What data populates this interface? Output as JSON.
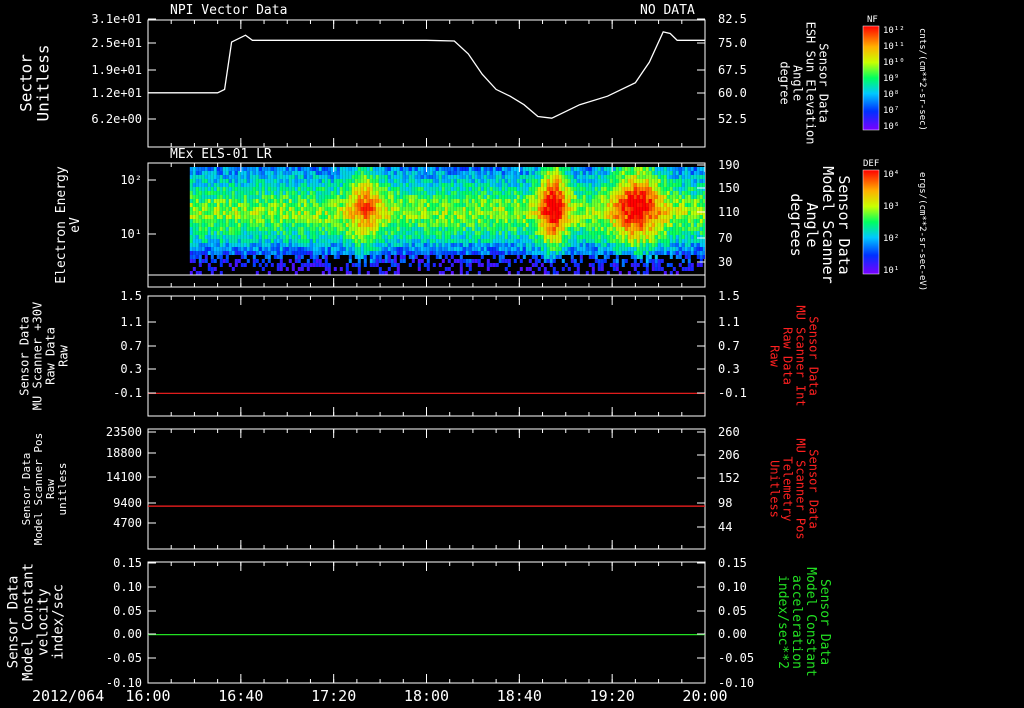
{
  "colors": {
    "white": "#ffffff",
    "red": "#ff2020",
    "green": "#22e022",
    "axis": "#ffffff"
  },
  "chart_data": [
    {
      "type": "line",
      "panel": "p1",
      "title": "NPI Vector Data",
      "status": "NO DATA",
      "ylabel_left": [
        "Sector",
        "Unitless"
      ],
      "yticks_left": [
        "3.1e+01",
        "2.5e+01",
        "1.9e+01",
        "1.2e+01",
        "6.2e+00"
      ],
      "ylabel_right": [
        "Sensor Data",
        "ESH Sun Elevation",
        "Angle",
        "degree"
      ],
      "yticks_right": [
        "82.5",
        "75.0",
        "67.5",
        "60.0",
        "52.5"
      ],
      "ylim": [
        45,
        82.5
      ],
      "xlim": [
        16.0,
        20.0
      ],
      "series": [
        {
          "color": "white",
          "x": [
            16.0,
            16.5,
            16.55,
            16.6,
            16.7,
            16.75,
            17.0,
            17.5,
            18.0,
            18.2,
            18.3,
            18.4,
            18.5,
            18.6,
            18.7,
            18.8,
            18.9,
            19.0,
            19.1,
            19.3,
            19.5,
            19.55,
            19.6,
            19.7,
            19.75,
            19.8,
            20.0
          ],
          "y": [
            61.0,
            61.0,
            62.0,
            76.0,
            78.0,
            76.5,
            76.5,
            76.5,
            76.5,
            76.3,
            72.5,
            66.5,
            62.0,
            60.0,
            57.5,
            54.0,
            53.5,
            55.5,
            57.5,
            60.0,
            64.0,
            67.0,
            70.0,
            79.0,
            78.5,
            76.5,
            76.5
          ]
        }
      ]
    },
    {
      "type": "heatmap",
      "panel": "p2",
      "title": "MEx ELS-01 LR",
      "ylabel_left": [
        "Electron Energy",
        "eV"
      ],
      "yticks_left": [
        "10²",
        "10¹"
      ],
      "ylabel_right": [
        "Sensor Data",
        "Model Scanner",
        "Angle",
        "degrees"
      ],
      "yticks_right": [
        "190",
        "150",
        "110",
        "70",
        "30"
      ],
      "ylim_right": [
        0,
        190
      ],
      "xlim": [
        16.0,
        20.0
      ],
      "data_start": 16.3
    },
    {
      "type": "line",
      "panel": "p3",
      "ylabel_left": [
        "Sensor Data",
        "MU Scanner +30V",
        "Raw Data",
        "Raw"
      ],
      "yticks_left": [
        "1.5",
        "1.1",
        "0.7",
        "0.3",
        "-0.1"
      ],
      "ylabel_right": [
        "Sensor Data",
        "MU Scanner Int",
        "Raw Data",
        "Raw"
      ],
      "yticks_right": [
        "1.5",
        "1.1",
        "0.7",
        "0.3",
        "-0.1"
      ],
      "ylim": [
        -0.35,
        1.5
      ],
      "xlim": [
        16.0,
        20.0
      ],
      "series": [
        {
          "color": "red",
          "x": [
            16.0,
            20.0
          ],
          "y": [
            0.0,
            0.0
          ]
        }
      ]
    },
    {
      "type": "line",
      "panel": "p4",
      "ylabel_left": [
        "Sensor Data",
        "Model Scanner Pos",
        "Raw",
        "unitless"
      ],
      "yticks_left": [
        "23500",
        "18800",
        "14100",
        "9400",
        "4700"
      ],
      "ylabel_right": [
        "Sensor Data",
        "MU Scanner Pos",
        "Telemetry",
        "Unitless"
      ],
      "yticks_right": [
        "260",
        "206",
        "152",
        "98",
        "44"
      ],
      "ylim": [
        0,
        23500
      ],
      "xlim": [
        16.0,
        20.0
      ],
      "series": [
        {
          "color": "red",
          "x": [
            16.0,
            20.0
          ],
          "y": [
            8400,
            8400
          ]
        }
      ]
    },
    {
      "type": "line",
      "panel": "p5",
      "ylabel_left": [
        "Sensor Data",
        "Model Constant",
        "velocity",
        "index/sec"
      ],
      "yticks_left": [
        "0.15",
        "0.10",
        "0.05",
        "0.00",
        "-0.05",
        "-0.10"
      ],
      "ylabel_right": [
        "Sensor Data",
        "Model Constant",
        "acceleration",
        "index/sec**2"
      ],
      "yticks_right": [
        "0.15",
        "0.10",
        "0.05",
        "0.00",
        "-0.05",
        "-0.10"
      ],
      "ylim": [
        -0.1,
        0.15
      ],
      "xlim": [
        16.0,
        20.0
      ],
      "series": [
        {
          "color": "green",
          "x": [
            16.0,
            20.0
          ],
          "y": [
            0.0,
            0.0
          ]
        }
      ]
    }
  ],
  "xaxis": {
    "date": "2012/064",
    "ticks": [
      "16:00",
      "16:40",
      "17:20",
      "18:00",
      "18:40",
      "19:20",
      "20:00"
    ],
    "tick_values": [
      16.0,
      16.6667,
      17.3333,
      18.0,
      18.6667,
      19.3333,
      20.0
    ]
  },
  "colorbars": [
    {
      "name": "NF",
      "units": "cnts/(cm**2-sr-sec)",
      "ticks": [
        "10¹²",
        "10¹¹",
        "10¹⁰",
        "10⁹",
        "10⁸",
        "10⁷",
        "10⁶"
      ]
    },
    {
      "name": "DEF",
      "units": "ergs/(cm**2-sr-sec-eV)",
      "ticks": [
        "10⁴",
        "10³",
        "10²",
        "10¹"
      ]
    }
  ]
}
